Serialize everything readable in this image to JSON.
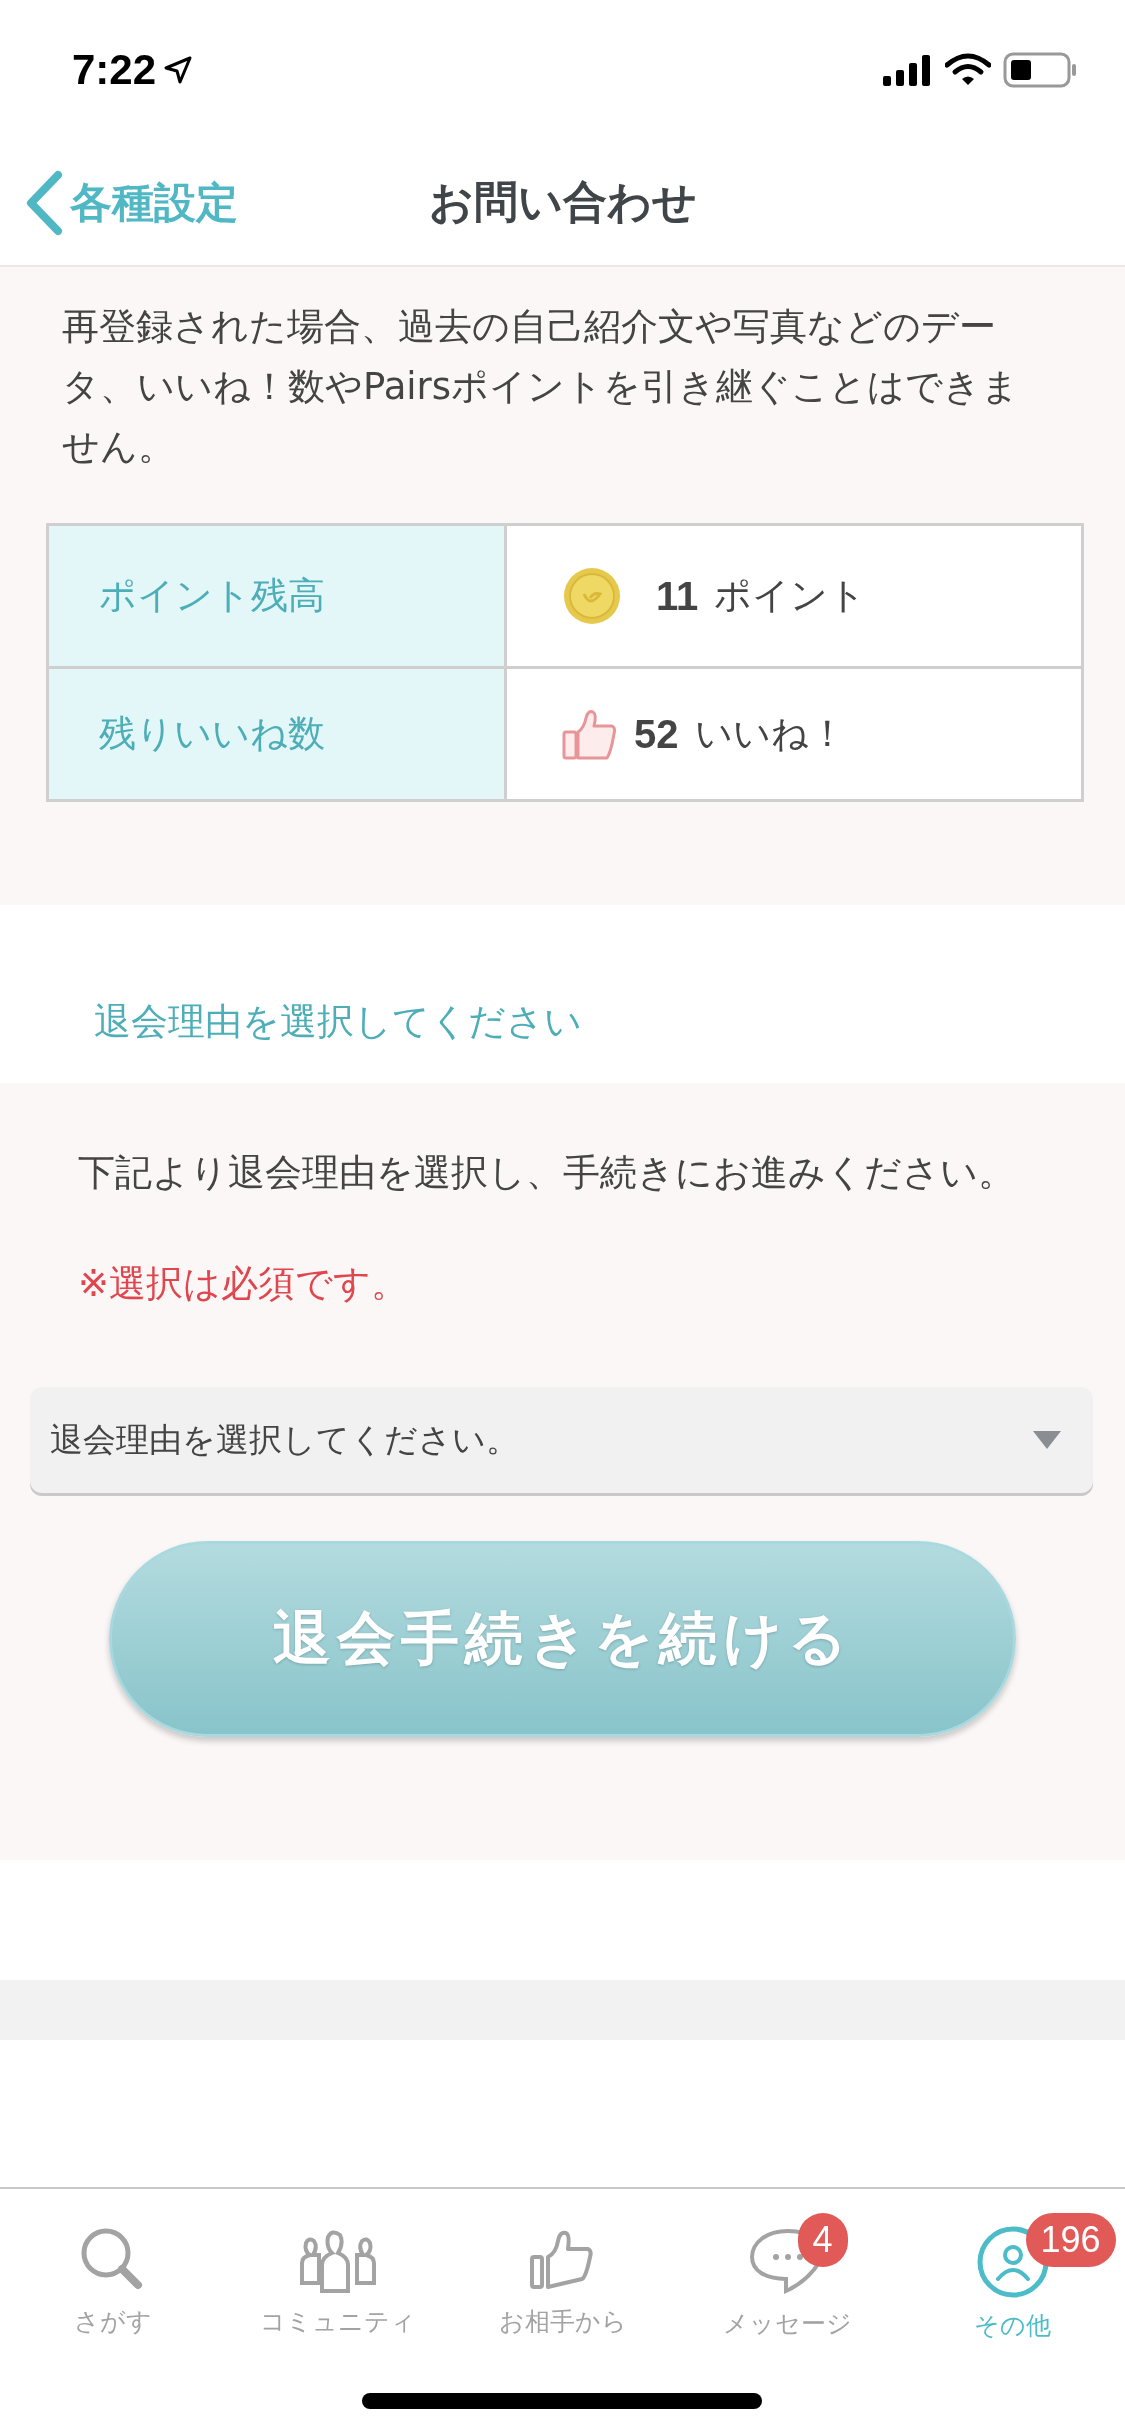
{
  "status_bar": {
    "time": "7:22"
  },
  "nav": {
    "back_label": "各種設定",
    "title": "お問い合わせ"
  },
  "notice": "再登録された場合、過去の自己紹介文や写真などのデータ、いいね！数やPairsポイントを引き継ぐことはできません。",
  "balance_table": [
    {
      "kind": "points",
      "label": "ポイント残高",
      "value": "11",
      "unit": "ポイント"
    },
    {
      "kind": "likes",
      "label": "残りいいね数",
      "value": "52",
      "unit": "いいね！"
    }
  ],
  "reason_heading": "退会理由を選択してください",
  "instructions": "下記より退会理由を選択し、手続きにお進みください。",
  "required_note": "※選択は必須です。",
  "reason_select": {
    "placeholder": "退会理由を選択してください。"
  },
  "continue_button": "退会手続きを続ける",
  "tabs": [
    {
      "kind": "search",
      "label": "さがす",
      "selected": false
    },
    {
      "kind": "community",
      "label": "コミュニティ",
      "selected": false
    },
    {
      "kind": "likes",
      "label": "お相手から",
      "selected": false
    },
    {
      "kind": "messages",
      "label": "メッセージ",
      "selected": false,
      "badge": "4"
    },
    {
      "kind": "other",
      "label": "その他",
      "selected": true,
      "badge": "196"
    }
  ]
}
